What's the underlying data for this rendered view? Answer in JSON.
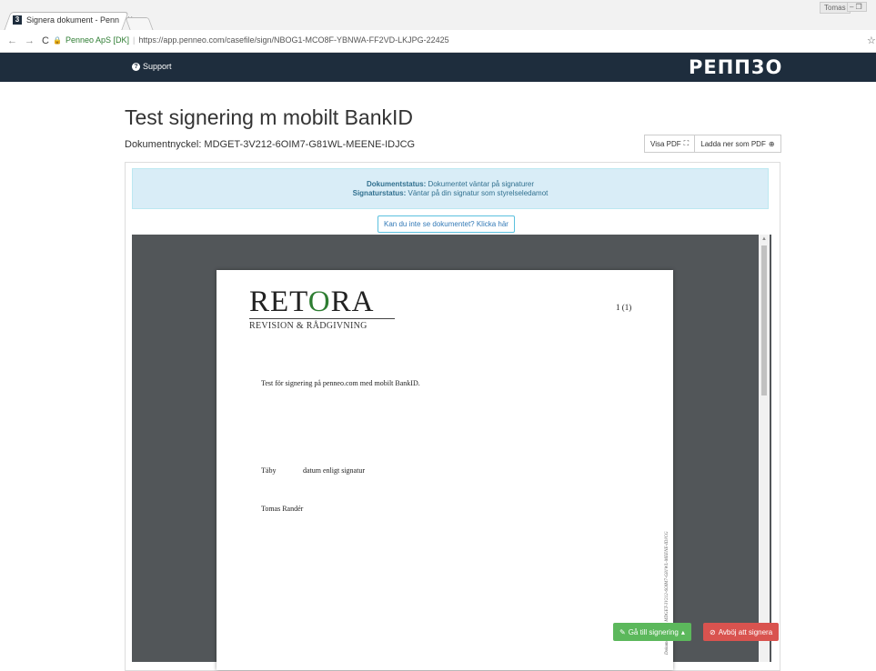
{
  "browser": {
    "tab_title": "Signera dokument - Penn",
    "favicon_letter": "3",
    "tab_close": "×",
    "user": "Tomas",
    "window_controls": "–❐",
    "secure_label": "Penneo ApS [DK]",
    "url": "https://app.penneo.com/casefile/sign/NBOG1-MCO8F-YBNWA-FF2VD-LKJPG-22425"
  },
  "navbar": {
    "support_label": "Support",
    "brand": "PEΠΠ3O"
  },
  "header": {
    "title": "Test signering m mobilt BankID",
    "document_key": "Dokumentnyckel: MDGET-3V212-6OIM7-G81WL-MEENE-IDJCG",
    "view_pdf_label": "Visa PDF",
    "download_pdf_label": "Ladda ner som PDF"
  },
  "status": {
    "doc_status_label": "Dokumentstatus:",
    "doc_status_value": "Dokumentet väntar på signaturer",
    "sig_status_label": "Signaturstatus:",
    "sig_status_value": "Väntar på din signatur som styrelseledamot"
  },
  "cant_see_link": "Kan du inte se dokumentet? Klicka här",
  "document": {
    "logo_pre": "RET",
    "logo_o": "O",
    "logo_post": "RA",
    "logo_sub": "REVISION & RÅDGIVNING",
    "page_number": "1 (1)",
    "body_line": "Test för signering på penneo.com med mobilt BankID.",
    "place": "Täby",
    "date_line": "datum enligt signatur",
    "signer": "Tomas Randér",
    "margin_key": "Dokumentnyckel: MDGET-3V212-6OIM7-G81WL-MEENE-IDJCG"
  },
  "actions": {
    "sign_label": "Gå till signering",
    "reject_label": "Avböj att signera"
  },
  "colors": {
    "navbar": "#1e2d3d",
    "sign_button": "#5cb85c",
    "reject_button": "#d9534f",
    "alert_bg": "#d9edf7"
  }
}
